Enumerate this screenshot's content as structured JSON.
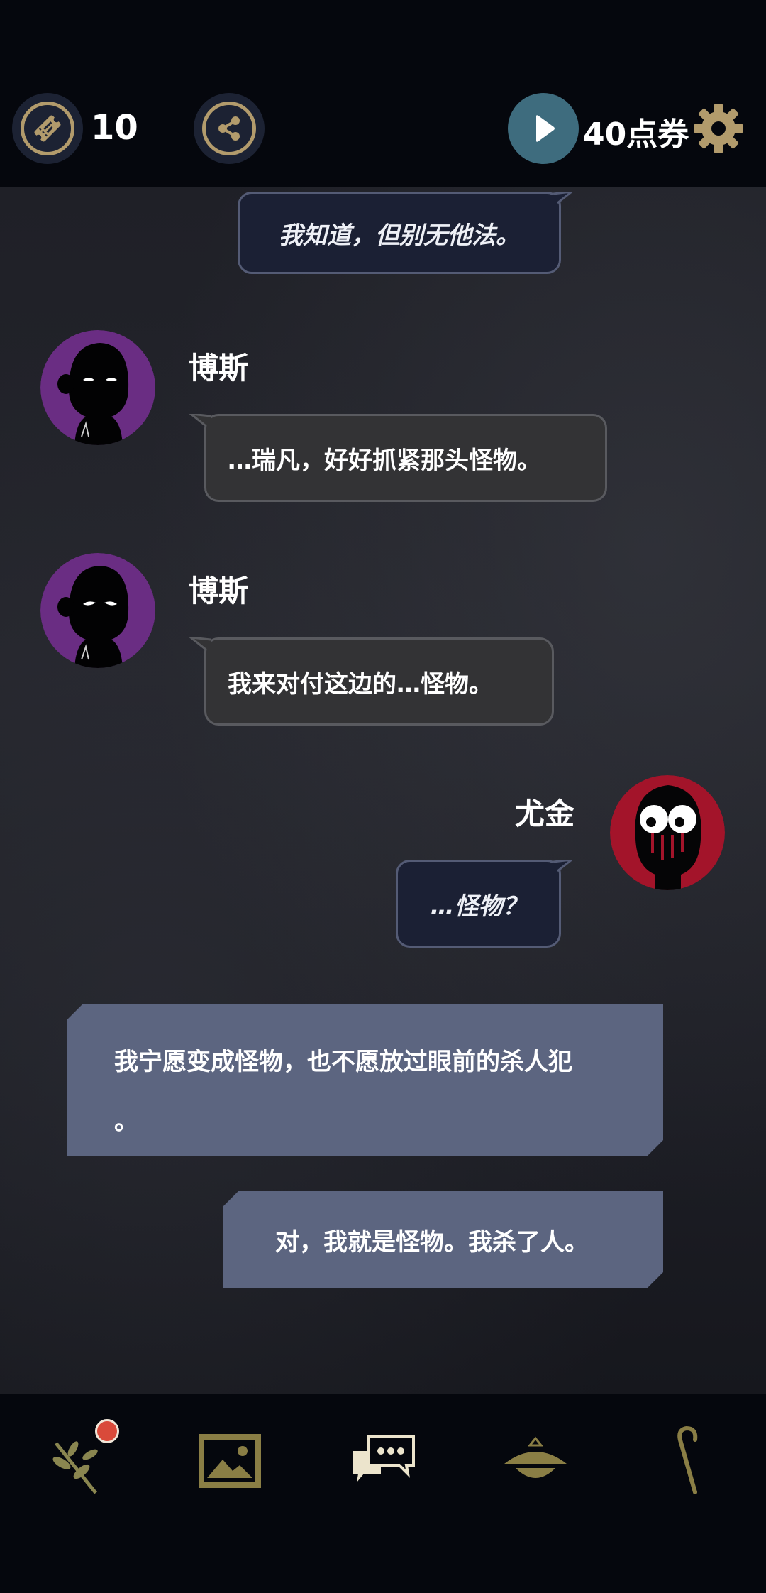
{
  "topbar": {
    "tickets": {
      "icon": "ticket-icon",
      "count": "10"
    },
    "share": {
      "icon": "share-icon"
    },
    "play": {
      "icon": "play-icon"
    },
    "coupons": {
      "label": "40点券"
    },
    "settings": {
      "icon": "gear-icon"
    }
  },
  "chat": {
    "messages": [
      {
        "kind": "player",
        "text": "我知道，但别无他法。"
      },
      {
        "kind": "npc",
        "speaker": "博斯",
        "text": "…瑞凡，好好抓紧那头怪物。"
      },
      {
        "kind": "npc",
        "speaker": "博斯",
        "text": "我来对付这边的…怪物。"
      },
      {
        "kind": "player",
        "speaker": "尤金",
        "text": "…怪物？"
      },
      {
        "kind": "narration",
        "text_line1": "我宁愿变成怪物，也不愿放过眼前的杀人犯",
        "text_line2": "。"
      },
      {
        "kind": "narration",
        "text": "对，我就是怪物。我杀了人。"
      }
    ]
  },
  "bottomnav": {
    "items": [
      {
        "icon": "branch-icon",
        "badge": true
      },
      {
        "icon": "gallery-icon"
      },
      {
        "icon": "chat-icon",
        "active": true
      },
      {
        "icon": "lamp-icon"
      },
      {
        "icon": "cane-icon"
      }
    ]
  },
  "colors": {
    "accent_gold": "#b29b6c",
    "play_teal": "#3e6c7e",
    "npc_avatar_purple": "#6a2d83",
    "player_avatar_red": "#a3142a",
    "narration_bg": "#5c6580",
    "badge_red": "#d94a3a"
  }
}
